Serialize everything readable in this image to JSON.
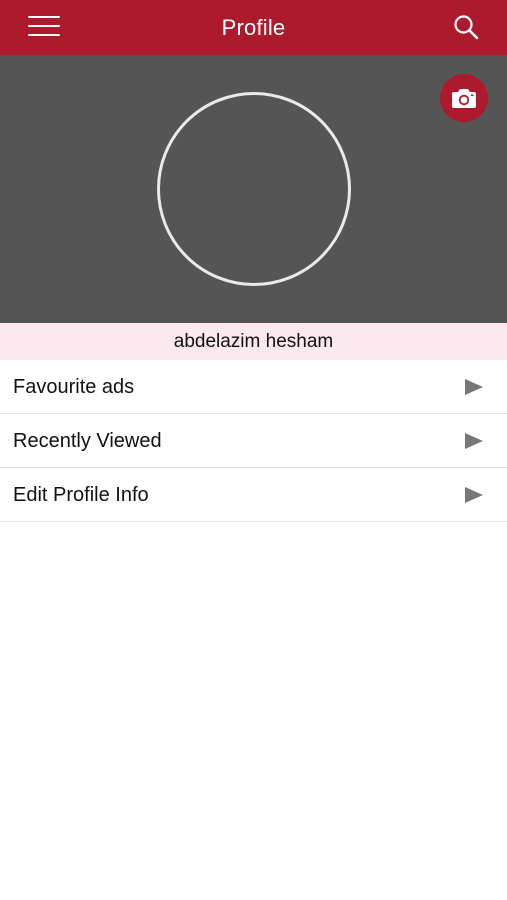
{
  "header": {
    "title": "Profile",
    "menu_icon": "hamburger-menu-icon",
    "search_icon": "search-icon",
    "background_color": "#ad1a2d"
  },
  "profile": {
    "name": "abdelazim hesham",
    "camera_icon": "camera-icon",
    "cover_color": "#555555",
    "name_bar_color": "#fbe9ef"
  },
  "menu": {
    "items": [
      {
        "label": "Favourite ads",
        "icon": "play-arrow-icon"
      },
      {
        "label": "Recently Viewed",
        "icon": "play-arrow-icon"
      },
      {
        "label": "Edit Profile Info",
        "icon": "play-arrow-icon"
      }
    ]
  }
}
